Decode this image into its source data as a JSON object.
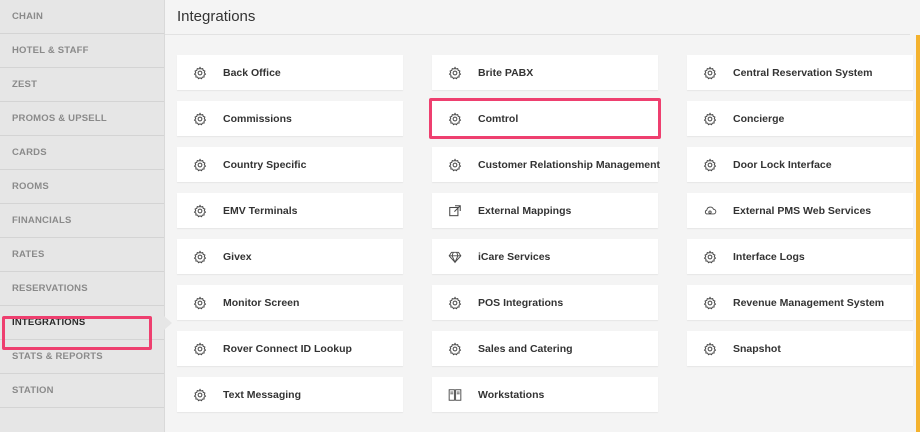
{
  "page": {
    "title": "Integrations"
  },
  "sidebar": {
    "items": [
      {
        "label": "CHAIN"
      },
      {
        "label": "HOTEL & STAFF"
      },
      {
        "label": "ZEST"
      },
      {
        "label": "PROMOS & UPSELL"
      },
      {
        "label": "CARDS"
      },
      {
        "label": "ROOMS"
      },
      {
        "label": "FINANCIALS"
      },
      {
        "label": "RATES"
      },
      {
        "label": "RESERVATIONS"
      },
      {
        "label": "INTEGRATIONS"
      },
      {
        "label": "STATS & REPORTS"
      },
      {
        "label": "STATION"
      }
    ],
    "active": "INTEGRATIONS"
  },
  "columns": [
    [
      {
        "label": "Back Office",
        "icon": "gear-icon"
      },
      {
        "label": "Commissions",
        "icon": "gear-icon"
      },
      {
        "label": "Country Specific",
        "icon": "gear-icon"
      },
      {
        "label": "EMV Terminals",
        "icon": "gear-icon"
      },
      {
        "label": "Givex",
        "icon": "gear-icon"
      },
      {
        "label": "Monitor Screen",
        "icon": "gear-icon"
      },
      {
        "label": "Rover Connect ID Lookup",
        "icon": "gear-icon"
      },
      {
        "label": "Text Messaging",
        "icon": "gear-icon"
      }
    ],
    [
      {
        "label": "Brite PABX",
        "icon": "gear-icon"
      },
      {
        "label": "Comtrol",
        "icon": "gear-icon"
      },
      {
        "label": "Customer Relationship Management",
        "icon": "gear-icon"
      },
      {
        "label": "External Mappings",
        "icon": "external-link-icon"
      },
      {
        "label": "iCare Services",
        "icon": "diamond-icon"
      },
      {
        "label": "POS Integrations",
        "icon": "gear-icon"
      },
      {
        "label": "Sales and Catering",
        "icon": "gear-icon"
      },
      {
        "label": "Workstations",
        "icon": "workstation-icon"
      }
    ],
    [
      {
        "label": "Central Reservation System",
        "icon": "gear-icon"
      },
      {
        "label": "Concierge",
        "icon": "gear-icon"
      },
      {
        "label": "Door Lock Interface",
        "icon": "gear-icon"
      },
      {
        "label": "External PMS Web Services",
        "icon": "cloud-gear-icon"
      },
      {
        "label": "Interface Logs",
        "icon": "gear-icon"
      },
      {
        "label": "Revenue Management System",
        "icon": "gear-icon"
      },
      {
        "label": "Snapshot",
        "icon": "gear-icon"
      }
    ]
  ],
  "colors": {
    "highlight": "#ee3f6f",
    "scroll_accent": "#f4b22e"
  }
}
